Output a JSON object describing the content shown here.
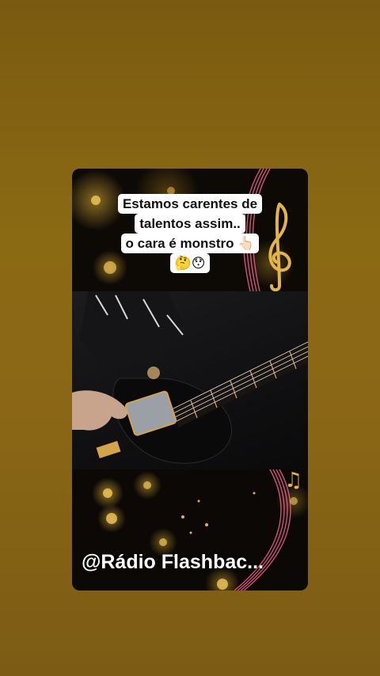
{
  "post": {
    "caption_lines": [
      "Estamos carentes de",
      "talentos assim..",
      "o cara é monstro 👆🏻",
      "🤔😯"
    ],
    "watermark": "@Rádio Flashbac..."
  },
  "colors": {
    "background": "#8b6a14",
    "caption_bg": "#ffffff",
    "caption_text": "#111111",
    "watermark_text": "#ffffff",
    "accent_gold": "#e2b44a",
    "accent_pink": "#e85a8a"
  },
  "icons": [
    "treble-clef-icon",
    "music-staff-decoration",
    "electric-guitar-image"
  ]
}
